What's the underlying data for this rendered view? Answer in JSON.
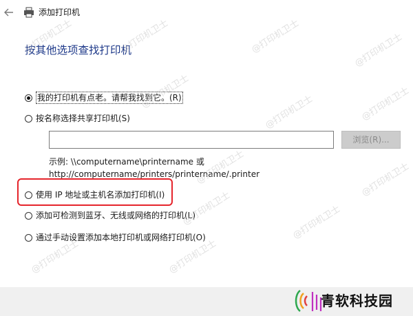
{
  "window": {
    "title": "添加打印机"
  },
  "heading": "按其他选项查找打印机",
  "options": [
    {
      "label": "我的打印机有点老。请帮我找到它。(R)",
      "checked": true
    },
    {
      "label": "按名称选择共享打印机(S)",
      "checked": false
    },
    {
      "label": "使用 IP 地址或主机名添加打印机(I)",
      "checked": false
    },
    {
      "label": "添加可检测到蓝牙、无线或网络的打印机(L)",
      "checked": false
    },
    {
      "label": "通过手动设置添加本地打印机或网络打印机(O)",
      "checked": false
    }
  ],
  "share_input": {
    "value": ""
  },
  "browse_button": "浏览(R)...",
  "example": {
    "line1": "示例: \\\\computername\\printername 或",
    "line2": "http://computername/printers/printername/.printer"
  },
  "watermark": "@打印机卫士",
  "brand": {
    "name": "青软科技园"
  },
  "colors": {
    "heading": "#1f3a8a",
    "highlight": "#e5242b",
    "bottom_bar": "#f0f0f0"
  }
}
